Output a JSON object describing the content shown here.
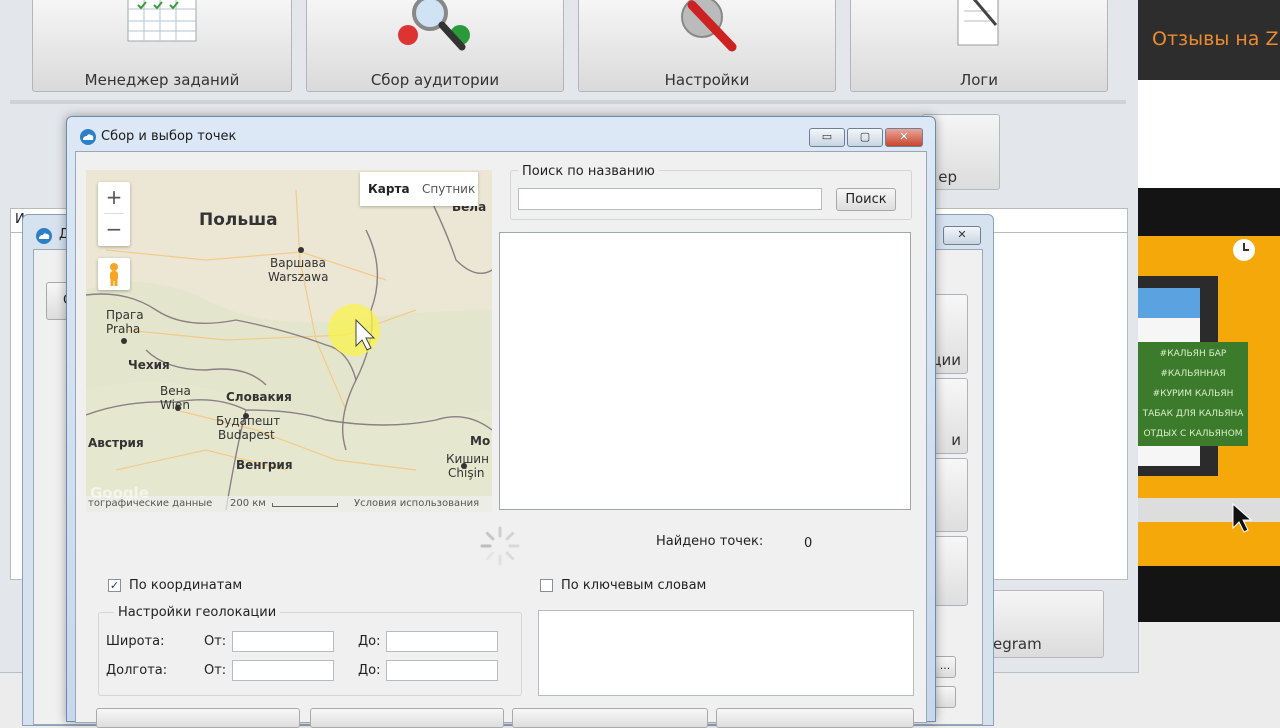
{
  "toolbar": {
    "task_manager": "Менеджер заданий",
    "audience": "Сбор аудитории",
    "settings": "Настройки",
    "logs": "Логи"
  },
  "background": {
    "partial_button_1": "ер",
    "partial_label_1": "и",
    "partial_btn_ucii": "ции",
    "partial_btn_i": "и",
    "partial_gram": "egram",
    "partial_dots": "...",
    "partial_small_d": "Д",
    "partial_small_c": "С",
    "partial_small_i": "И"
  },
  "right_panel": {
    "reviews": "Отзывы на Zi",
    "tags": [
      "#КАЛЬЯН БАР",
      "#КАЛЬЯННАЯ",
      "#КУРИМ КАЛЬЯН",
      "ТАБАК ДЛЯ КАЛЬЯНА",
      "ОТДЫХ С КАЛЬЯНОМ"
    ]
  },
  "dialog": {
    "title": "Сбор и выбор точек",
    "controls": {
      "minimize": "▭",
      "maximize": "▢",
      "close": "✕"
    }
  },
  "map": {
    "maptype_map": "Карта",
    "maptype_satellite": "Спутник",
    "zoom_in": "+",
    "zoom_out": "−",
    "labels": {
      "poland": "Польша",
      "warsaw_ru": "Варшава",
      "warsaw": "Warszawa",
      "prague_ru": "Прага",
      "prague": "Praha",
      "czech": "Чехия",
      "vienna_ru": "Вена",
      "vienna": "Wien",
      "slovakia": "Словакия",
      "budapest_ru": "Будапешт",
      "budapest": "Budapest",
      "austria": "Австрия",
      "hungary": "Венгрия",
      "bela": "Бела",
      "mo": "Мо",
      "kishinev_ru": "Кишин",
      "chisin": "Chişin"
    },
    "footer_data": "тографические данные",
    "footer_scale": "200 км",
    "footer_terms": "Условия использования",
    "google": "Google"
  },
  "search": {
    "group_label": "Поиск по названию",
    "input_value": "",
    "button": "Поиск"
  },
  "found": {
    "label": "Найдено точек:",
    "count": "0"
  },
  "options": {
    "by_coordinates": "По координатам",
    "by_coordinates_checked": true,
    "by_keywords": "По ключевым словам",
    "by_keywords_checked": false
  },
  "geo": {
    "group_label": "Настройки геолокации",
    "latitude": "Широта:",
    "longitude": "Долгота:",
    "from": "От:",
    "to": "До:",
    "lat_from": "",
    "lat_to": "",
    "lon_from": "",
    "lon_to": ""
  }
}
